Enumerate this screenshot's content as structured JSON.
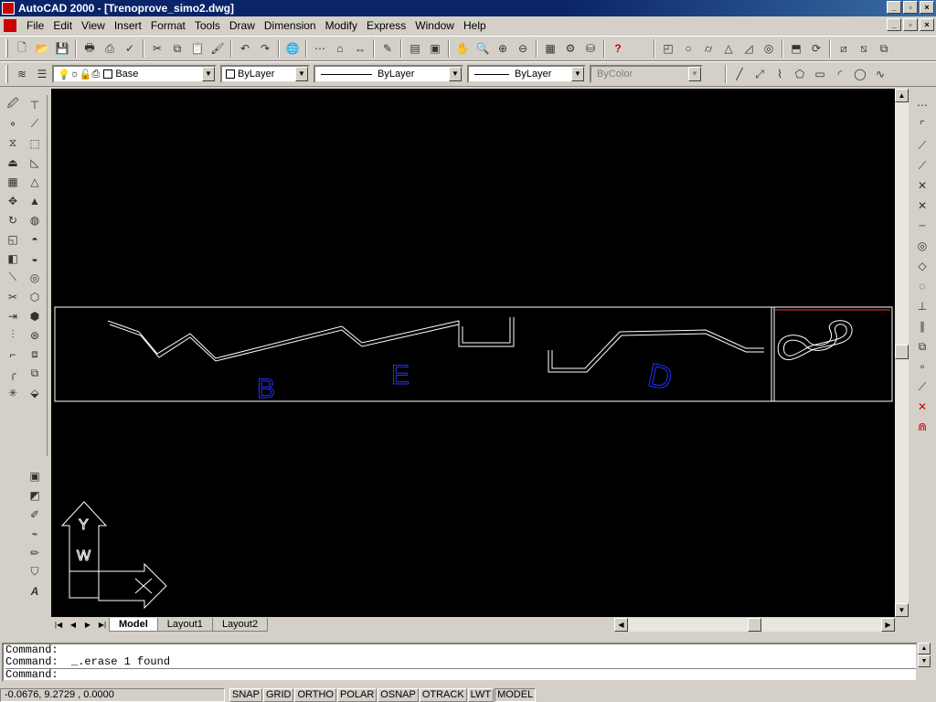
{
  "window": {
    "title": "AutoCAD 2000 - [Trenoprove_simo2.dwg]",
    "controls": [
      "_",
      "▫",
      "×"
    ]
  },
  "menu": [
    "File",
    "Edit",
    "View",
    "Insert",
    "Format",
    "Tools",
    "Draw",
    "Dimension",
    "Modify",
    "Express",
    "Window",
    "Help"
  ],
  "properties": {
    "layer_value": "Base",
    "color_value": "ByLayer",
    "linetype_value": "ByLayer",
    "lineweight_value": "ByLayer",
    "plotstyle_value": "ByColor"
  },
  "drawing": {
    "labels": [
      "B",
      "E",
      "D"
    ],
    "colors": {
      "background": "#000000",
      "geometry": "#ffffff",
      "label": "#2233ff",
      "accent": "#ff3333"
    },
    "ucs": {
      "y_label": "Y",
      "w_label": "W"
    }
  },
  "layout_tabs": [
    "Model",
    "Layout1",
    "Layout2"
  ],
  "command": {
    "history": [
      "Command:",
      "Command:  _.erase 1 found"
    ],
    "prompt": "Command:"
  },
  "status": {
    "coords": "-0.0676, 9.2729 , 0.0000",
    "toggles": [
      "SNAP",
      "GRID",
      "ORTHO",
      "POLAR",
      "OSNAP",
      "OTRACK",
      "LWT",
      "MODEL"
    ],
    "pressed": "MODEL"
  }
}
